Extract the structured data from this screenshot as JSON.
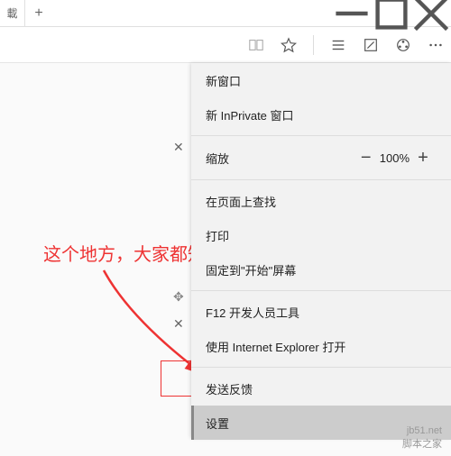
{
  "titlebar": {
    "tab_label": "載"
  },
  "menu": {
    "new_window": "新窗口",
    "new_inprivate": "新 InPrivate 窗口",
    "zoom_label": "缩放",
    "zoom_pct": "100%",
    "find": "在页面上查找",
    "print": "打印",
    "pin": "固定到\"开始\"屏幕",
    "devtools": "F12 开发人员工具",
    "open_ie": "使用 Internet Explorer 打开",
    "feedback": "发送反馈",
    "settings": "设置"
  },
  "annotation": {
    "red_text": "这个地方，大家都知道的"
  },
  "watermark": {
    "line1": "jb51.net",
    "line2": "脚本之家"
  }
}
